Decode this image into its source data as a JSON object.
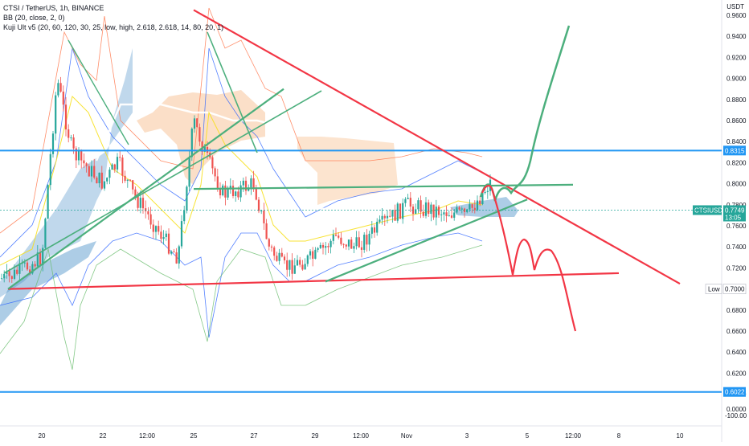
{
  "header": {
    "symbol_line": "CTSI / TetherUS, 1h, BINANCE",
    "indicator_1": "BB (20, close, 2, 0)",
    "indicator_2": "Kuji Ult v5 (20, 60, 120, 30, 25, low, high, 2.618, 2.618, 14, 80, 20, 1)"
  },
  "y_axis": {
    "unit": "USDT",
    "ticks": [
      "0.9600",
      "0.9400",
      "0.9200",
      "0.9000",
      "0.8800",
      "0.8600",
      "0.8400",
      "0.8200",
      "0.8000",
      "0.7800",
      "0.7600",
      "0.7400",
      "0.7200",
      "0.7000",
      "0.6800",
      "0.6600",
      "0.6400",
      "0.6200",
      "0.6000",
      "0.0000"
    ],
    "bottom_partial": "-100.00"
  },
  "x_axis": {
    "ticks": [
      "20",
      "22",
      "12:00",
      "25",
      "27",
      "29",
      "12:00",
      "Nov",
      "3",
      "5",
      "12:00",
      "8",
      "10"
    ]
  },
  "price_tags": {
    "level_high": "0.8315",
    "current_symbol": "CTSIUSDT",
    "current_price": "0.7749",
    "countdown": "13:05",
    "low_label": "Low",
    "low_value": "0.7000",
    "level_low": "0.6022"
  },
  "colors": {
    "blue_line": "#2196f3",
    "red_line": "#f23645",
    "green_line": "#4caf7d",
    "candle_up": "#26a69a",
    "candle_down": "#ef5350",
    "cloud_blue": "#4a90c8",
    "cloud_orange": "#f4a460"
  },
  "chart_data": {
    "type": "candlestick",
    "title": "CTSI / TetherUS, 1h, BINANCE",
    "x_range": [
      "Oct 19",
      "Nov 10"
    ],
    "ylim": [
      0.57,
      0.965
    ],
    "horizontal_levels": [
      0.8315,
      0.6022
    ],
    "current_price": 0.7749,
    "price_path_approx": [
      {
        "x": "Oct 19",
        "y": 0.71
      },
      {
        "x": "Oct 20",
        "y": 0.73
      },
      {
        "x": "Oct 20 12:00",
        "y": 0.9
      },
      {
        "x": "Oct 21",
        "y": 0.83
      },
      {
        "x": "Oct 22",
        "y": 0.8
      },
      {
        "x": "Oct 22 12:00",
        "y": 0.82
      },
      {
        "x": "Oct 23",
        "y": 0.79
      },
      {
        "x": "Oct 24",
        "y": 0.75
      },
      {
        "x": "Oct 24 12:00",
        "y": 0.73
      },
      {
        "x": "Oct 25",
        "y": 0.86
      },
      {
        "x": "Oct 25 12:00",
        "y": 0.82
      },
      {
        "x": "Oct 26",
        "y": 0.79
      },
      {
        "x": "Oct 27",
        "y": 0.8
      },
      {
        "x": "Oct 27 12:00",
        "y": 0.74
      },
      {
        "x": "Oct 28",
        "y": 0.72
      },
      {
        "x": "Oct 29",
        "y": 0.73
      },
      {
        "x": "Oct 30",
        "y": 0.75
      },
      {
        "x": "Oct 31",
        "y": 0.74
      },
      {
        "x": "Oct 31 12:00",
        "y": 0.76
      },
      {
        "x": "Nov 1",
        "y": 0.78
      },
      {
        "x": "Nov 2",
        "y": 0.77
      },
      {
        "x": "Nov 3",
        "y": 0.81
      },
      {
        "x": "Nov 3 12:00",
        "y": 0.7749
      }
    ],
    "drawn_trendlines": [
      {
        "color": "red",
        "points": [
          [
            "Oct 25",
            0.965
          ],
          [
            "Nov 8",
            0.705
          ]
        ]
      },
      {
        "color": "red",
        "points": [
          [
            "Oct 19",
            0.7
          ],
          [
            "Nov 6",
            0.715
          ]
        ]
      },
      {
        "color": "green",
        "points": [
          [
            "Oct 29 12:00",
            0.707
          ],
          [
            "Nov 4",
            0.785
          ]
        ]
      },
      {
        "color": "green",
        "points": [
          [
            "Oct 25",
            0.795
          ],
          [
            "Nov 5",
            0.799
          ]
        ]
      },
      {
        "color": "green",
        "points": [
          [
            "Oct 19",
            0.7
          ],
          [
            "Oct 28",
            0.89
          ]
        ]
      }
    ]
  }
}
